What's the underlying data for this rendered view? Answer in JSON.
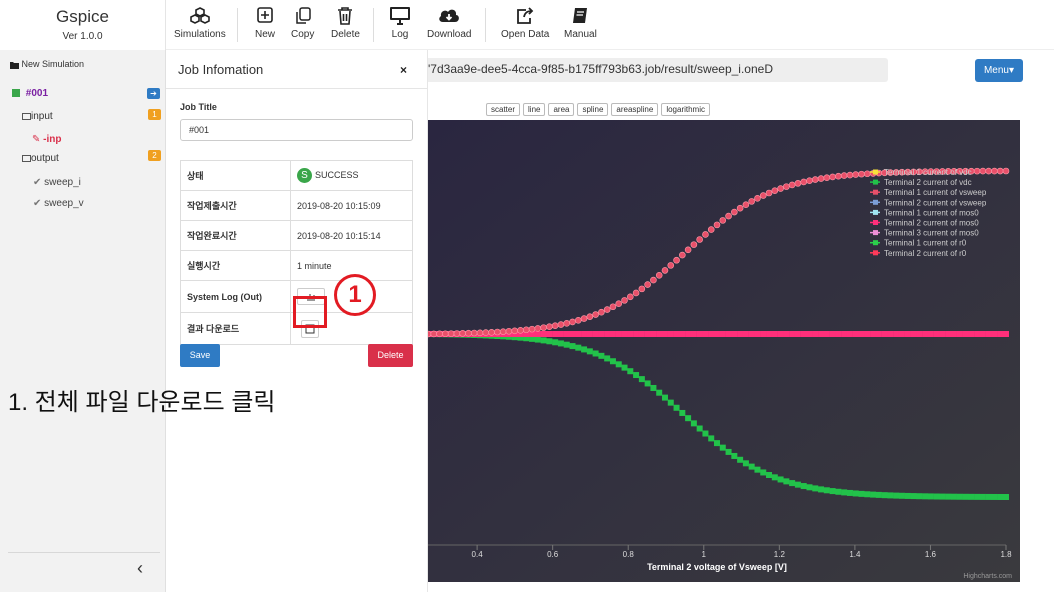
{
  "app": {
    "name": "Gspice",
    "version": "Ver 1.0.0"
  },
  "toolbar": {
    "simulations": "Simulations",
    "new": "New",
    "copy": "Copy",
    "delete": "Delete",
    "log": "Log",
    "download": "Download",
    "open_data": "Open Data",
    "manual": "Manual"
  },
  "sidebar": {
    "new_simulation": "New Simulation",
    "job": "#001",
    "input": "input",
    "input_badge": "1",
    "inp_file": "-inp",
    "output": "output",
    "output_badge": "2",
    "output_items": [
      "sweep_i",
      "sweep_v"
    ],
    "collapse": "‹"
  },
  "path": "'7d3aa9e-dee5-4cca-9f85-b175ff793b63.job/result/sweep_i.oneD",
  "menu_button": "Menu▾",
  "chart_types": [
    "scatter",
    "line",
    "area",
    "spline",
    "areaspline",
    "logarithmic"
  ],
  "panel": {
    "title": "Job Infomation",
    "close": "×",
    "job_title_label": "Job Title",
    "job_title_value": "#001",
    "rows": {
      "status_label": "상태",
      "status_value": "SUCCESS",
      "status_icon": "S",
      "submit_label": "작업제출시간",
      "submit_value": "2019-08-20 10:15:09",
      "done_label": "작업완료시간",
      "done_value": "2019-08-20 10:15:14",
      "exec_label": "실행시간",
      "exec_value": "1 minute",
      "log_label": "System Log (Out)",
      "result_label": "결과 다운로드"
    },
    "save": "Save",
    "delete": "Delete"
  },
  "annotation": {
    "marker": "1",
    "instruction": "1. 전체 파일 다운로드 클릭"
  },
  "colors": {
    "accent_blue": "#2f7bc4",
    "danger_red": "#d9304a",
    "highlight_red": "#e21b23",
    "success_green": "#3aa64a",
    "chart_bg": "#2a2a33"
  },
  "chart_data": {
    "type": "scatter",
    "xlabel": "Terminal 2 voltage of Vsweep [V]",
    "x_ticks": [
      "0.4",
      "0.6",
      "0.8",
      "1",
      "1.2",
      "1.4",
      "1.6",
      "1.8"
    ],
    "xlim": [
      0.27,
      1.8
    ],
    "credit": "Highcharts.com",
    "legend_position": "top-right",
    "legend": [
      {
        "name": "Terminal 1 current of vdc",
        "color": "#f7e23a"
      },
      {
        "name": "Terminal 2 current of vdc",
        "color": "#22c24a"
      },
      {
        "name": "Terminal 1 current of vsweep",
        "color": "#e8506a"
      },
      {
        "name": "Terminal 2 current of vsweep",
        "color": "#7b9ed8"
      },
      {
        "name": "Terminal 1 current of mos0",
        "color": "#9fe6f2"
      },
      {
        "name": "Terminal 2 current of mos0",
        "color": "#ff2f7a"
      },
      {
        "name": "Terminal 3 current of mos0",
        "color": "#f08fd8"
      },
      {
        "name": "Terminal 1 current of r0",
        "color": "#2bd14c"
      },
      {
        "name": "Terminal 2 current of r0",
        "color": "#ff3a5a"
      }
    ],
    "series_shapes": {
      "rising": {
        "color": "#e8506a",
        "description": "sigmoid rising from 0.3 to ~1.0 (relative)"
      },
      "flat": {
        "color": "#ff2f7a",
        "description": "constant at mid level"
      },
      "falling": {
        "color": "#22c24a",
        "description": "sigmoid falling from mid to low level"
      }
    },
    "grid": false
  }
}
